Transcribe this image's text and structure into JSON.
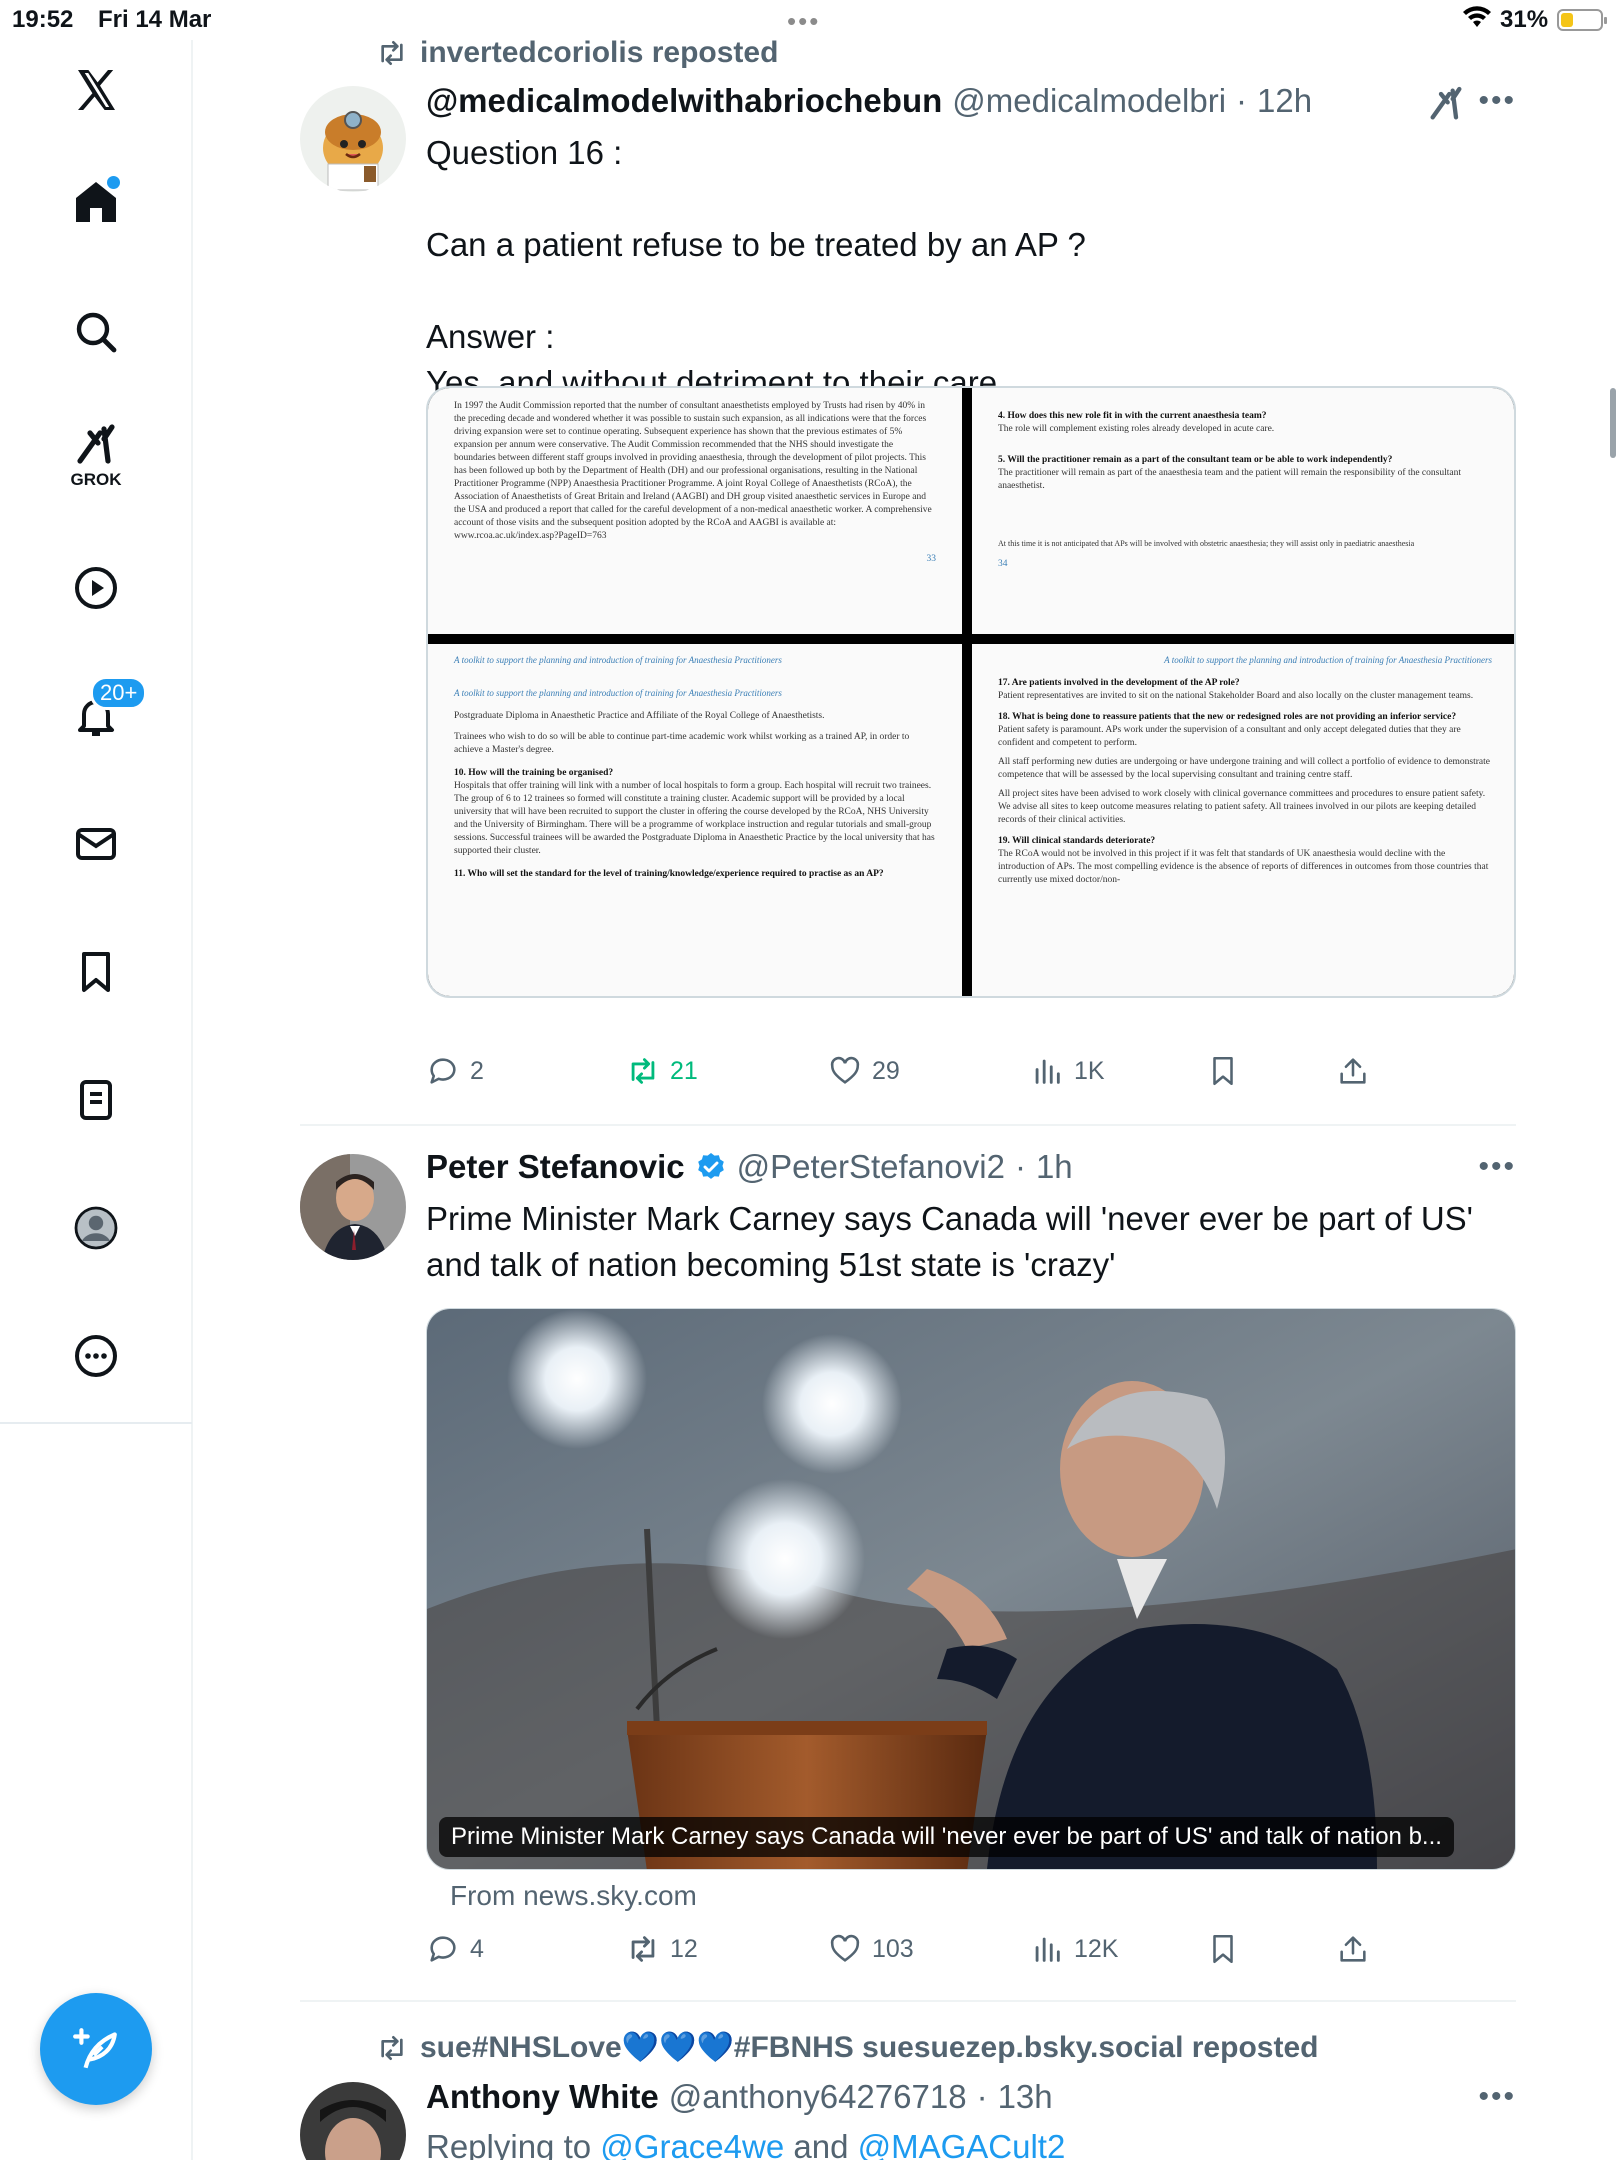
{
  "status_bar": {
    "time": "19:52",
    "date": "Fri 14 Mar",
    "battery": "31%"
  },
  "sidebar": {
    "notifications_badge": "20+",
    "grok_label": "GROK"
  },
  "posts": [
    {
      "repost_by": "invertedcoriolis reposted",
      "name": "@medicalmodelwithabriochebun",
      "handle": "@medicalmodelbri",
      "sep": "·",
      "time": "12h",
      "text_lines": [
        "Question 16 :",
        "",
        "Can a patient refuse to be treated by an AP ?",
        "",
        "Answer :",
        "Yes, and without detriment to their care"
      ],
      "doc": {
        "p1": "In 1997 the Audit Commission reported that the number of consultant anaesthetists employed by Trusts had risen by 40% in the preceding decade and wondered whether it was possible to sustain such expansion, as all indications were that the forces driving expansion were set to continue operating. Subsequent experience has shown that the previous estimates of 5% expansion per annum were conservative. The Audit Commission recommended that the NHS should investigate the boundaries between different staff groups involved in providing anaesthesia, through the development of pilot projects. This has been followed up both by the Department of Health (DH) and our professional organisations, resulting in the National Practitioner Programme (NPP) Anaesthesia Practitioner Programme. A joint Royal College of Anaesthetists (RCoA), the Association of Anaesthetists of Great Britain and Ireland (AAGBI) and DH group visited anaesthetic services in Europe and the USA and produced a report that called for the careful development of a non-medical anaesthetic worker. A comprehensive account of those visits and the subsequent position adopted by the RCoA and AAGBI is available at: www.rcoa.ac.uk/index.asp?PageID=763",
        "p1_page": "33",
        "p2_page": "34",
        "q4": "4. How does this new role fit in with the current anaesthesia team?",
        "a4": "The role will complement existing roles already developed in acute care.",
        "q5": "5. Will the practitioner remain as a part of the consultant team or be able to work independently?",
        "a5": "The practitioner will remain as part of the anaesthesia team and the patient will remain the responsibility of the consultant anaesthetist.",
        "fn": "At this time it is not anticipated that APs will be involved with obstetric anaesthesia; they will assist only in paediatric anaesthesia",
        "running_head": "A toolkit to support the planning and introduction of training for Anaesthesia Practitioners",
        "p3a": "Postgraduate Diploma in Anaesthetic Practice and Affiliate of the Royal College of Anaesthetists.",
        "p3b": "Trainees who wish to do so will be able to continue part-time academic work whilst working as a trained AP, in order to achieve a Master's degree.",
        "q10": "10. How will the training be organised?",
        "a10": "Hospitals that offer training will link with a number of local hospitals to form a group. Each hospital will recruit two trainees. The group of 6 to 12 trainees so formed will constitute a training cluster. Academic support will be provided by a local university that will have been recruited to support the cluster in offering the course developed by the RCoA, NHS University and the University of Birmingham. There will be a programme of workplace instruction and regular tutorials and small-group sessions. Successful trainees will be awarded the Postgraduate Diploma in Anaesthetic Practice by the local university that has supported their cluster.",
        "q11": "11. Who will set the standard for the level of training/knowledge/experience required to practise as an AP?",
        "q17": "17. Are patients involved in the development of the AP role?",
        "a17": "Patient representatives are invited to sit on the national Stakeholder Board and also locally on the cluster management teams.",
        "q18": "18. What is being done to reassure patients that the new or redesigned roles are not providing an inferior service?",
        "a18a": "Patient safety is paramount. APs work under the supervision of a consultant and only accept delegated duties that they are confident and competent to perform.",
        "a18b": "All staff performing new duties are undergoing or have undergone training and will collect a portfolio of evidence to demonstrate competence that will be assessed by the local supervising consultant and training centre staff.",
        "a18c": "All project sites have been advised to work closely with clinical governance committees and procedures to ensure patient safety. We advise all sites to keep outcome measures relating to patient safety. All trainees involved in our pilots are keeping detailed records of their clinical activities.",
        "q19": "19. Will clinical standards deteriorate?",
        "a19": "The RCoA would not be involved in this project if it was felt that standards of UK anaesthesia would decline with the introduction of APs. The most compelling evidence is the absence of reports of differences in outcomes from those countries that currently use mixed doctor/non-"
      },
      "actions": {
        "replies": "2",
        "reposts": "21",
        "likes": "29",
        "views": "1K"
      }
    },
    {
      "name": "Peter Stefanovic",
      "handle": "@PeterStefanovi2",
      "sep": "·",
      "time": "1h",
      "text_lines": [
        "Prime Minister Mark Carney says Canada will 'never ever be part of US'",
        "and talk of nation becoming 51st state is 'crazy'"
      ],
      "caption": "Prime Minister Mark Carney says Canada will 'never ever be part of US' and talk of nation b...",
      "source": "From news.sky.com",
      "actions": {
        "replies": "4",
        "reposts": "12",
        "likes": "103",
        "views": "12K"
      }
    },
    {
      "repost_by": "sue#NHSLove💙💙💙#FBNHS suesuezep.bsky.social reposted",
      "name": "Anthony White",
      "handle": "@anthony64276718",
      "sep": "·",
      "time": "13h",
      "reply_prefix": "Replying to",
      "reply_to_1": "@Grace4we",
      "reply_and": "and",
      "reply_to_2": "@MAGACult2"
    }
  ],
  "colors": {
    "accent": "#1d9bf0",
    "repost_green": "#00ba7c",
    "muted": "#536471"
  }
}
